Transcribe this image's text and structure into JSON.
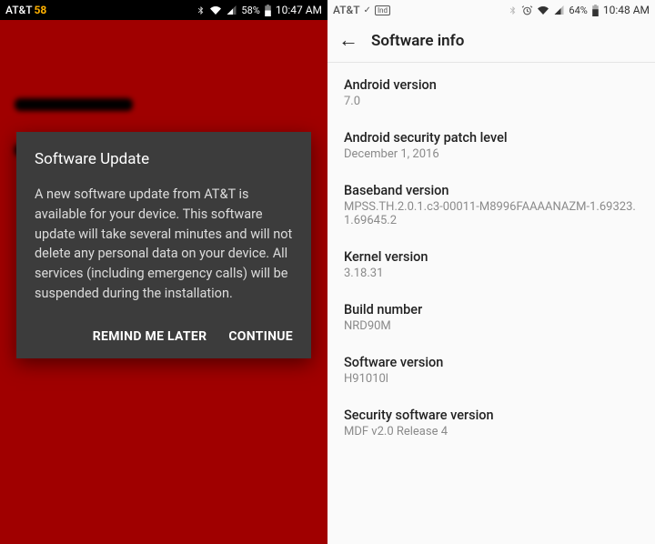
{
  "left": {
    "status": {
      "carrier": "AT&T",
      "carrier_extra": "58",
      "battery_pct": "58%",
      "time": "10:47 AM"
    },
    "dialog": {
      "title": "Software Update",
      "body": "A new software update from AT&T is available for your device. This software update will take several minutes and will not delete any personal data on your device. All services (including emergency calls) will be suspended during the installation.",
      "remind_label": "REMIND ME LATER",
      "continue_label": "CONTINUE"
    }
  },
  "right": {
    "status": {
      "carrier": "AT&T",
      "indicator_box": "Ind",
      "battery_pct": "64%",
      "time": "10:48 AM"
    },
    "header": {
      "title": "Software info"
    },
    "items": [
      {
        "label": "Android version",
        "value": "7.0"
      },
      {
        "label": "Android security patch level",
        "value": "December 1, 2016"
      },
      {
        "label": "Baseband version",
        "value": "MPSS.TH.2.0.1.c3-00011-M8996FAAAANAZM-1.69323.1.69645.2"
      },
      {
        "label": "Kernel version",
        "value": "3.18.31"
      },
      {
        "label": "Build number",
        "value": "NRD90M"
      },
      {
        "label": "Software version",
        "value": "H91010l"
      },
      {
        "label": "Security software version",
        "value": "MDF v2.0 Release 4"
      }
    ]
  }
}
